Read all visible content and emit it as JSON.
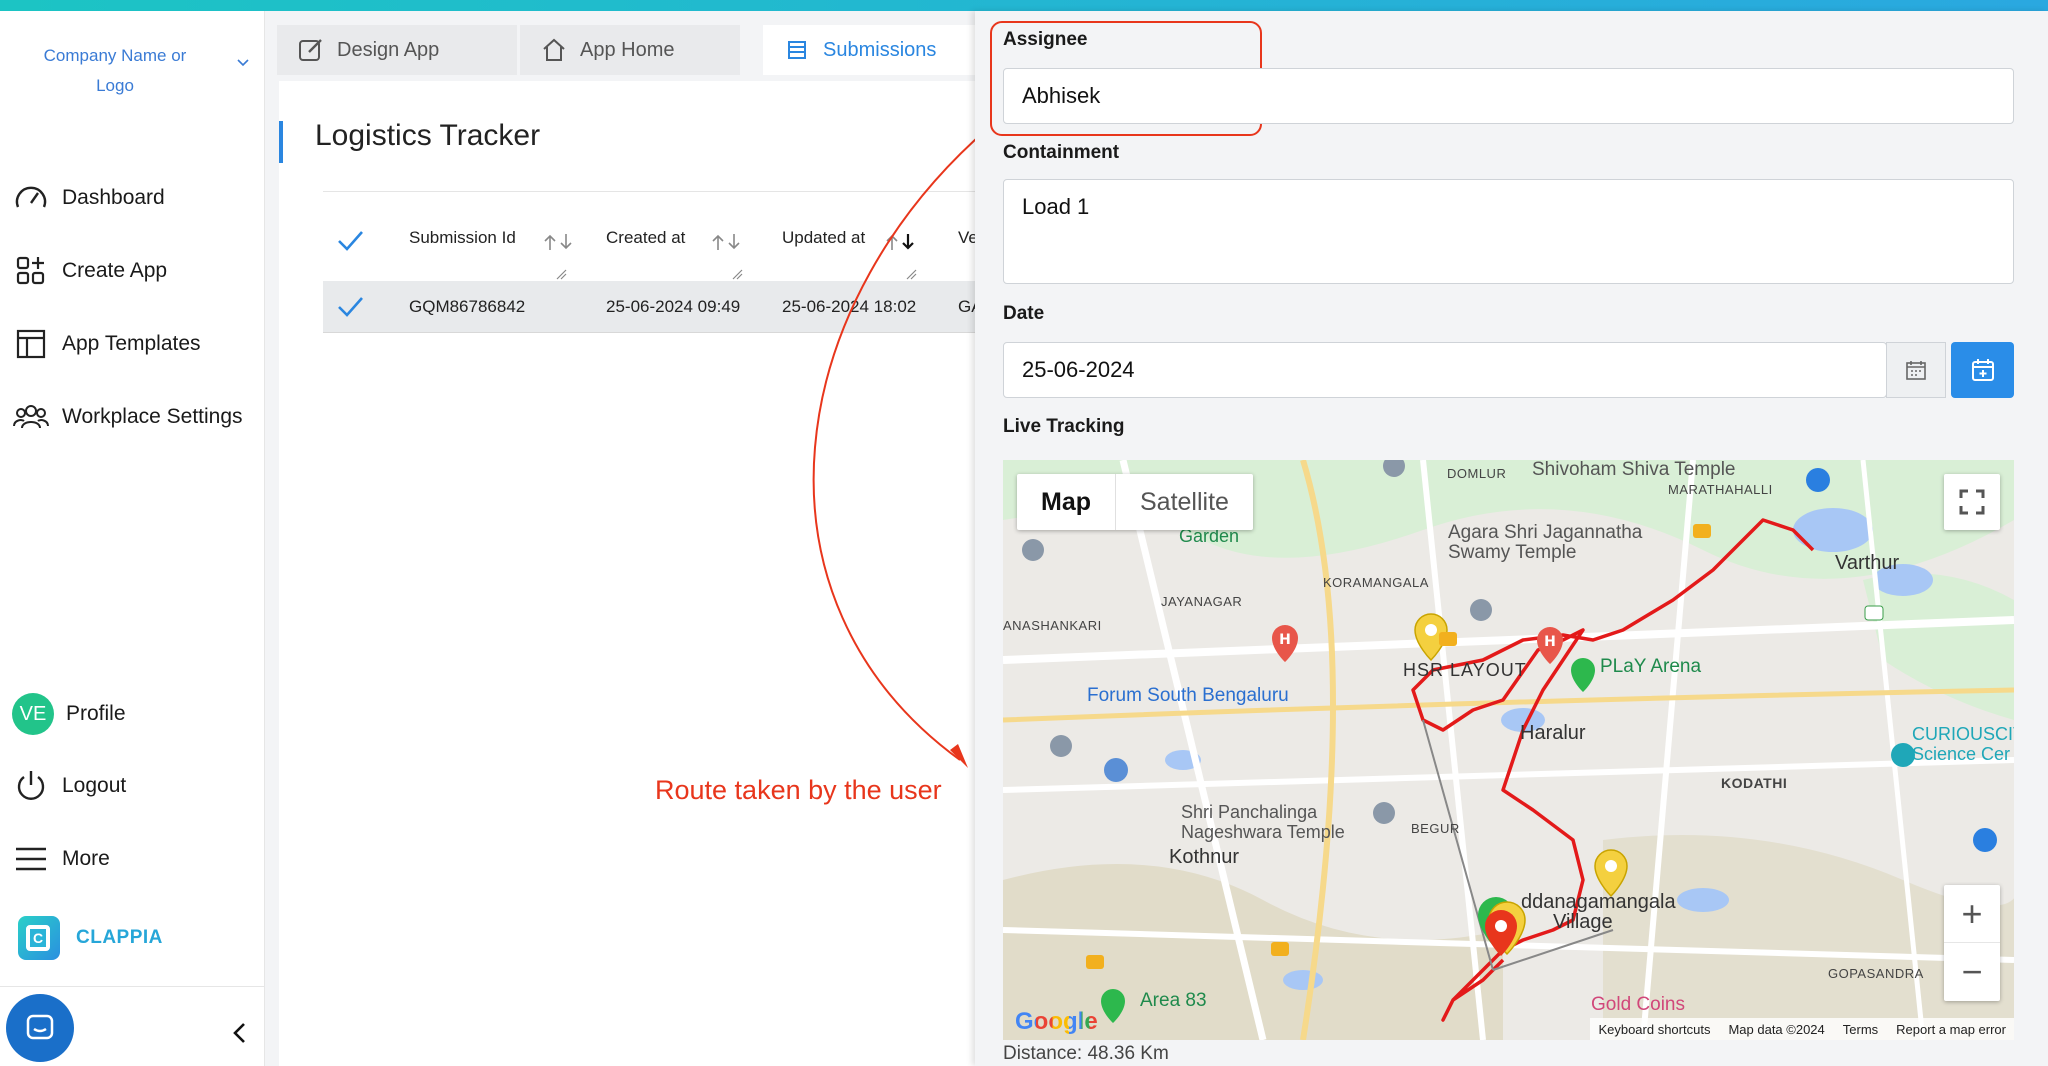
{
  "sidebar": {
    "company": "Company Name or Logo",
    "items": [
      {
        "label": "Dashboard",
        "icon": "speedometer-icon"
      },
      {
        "label": "Create App",
        "icon": "add-app-icon"
      },
      {
        "label": "App Templates",
        "icon": "templates-icon"
      },
      {
        "label": "Workplace Settings",
        "icon": "users-icon"
      }
    ],
    "profile": {
      "initials": "VE",
      "label": "Profile"
    },
    "logout": "Logout",
    "more": "More",
    "brand": "CLAPPIA"
  },
  "tabs": [
    {
      "label": "Design App",
      "icon": "edit-icon"
    },
    {
      "label": "App Home",
      "icon": "home-icon"
    },
    {
      "label": "Submissions",
      "icon": "table-icon",
      "active": true
    }
  ],
  "main": {
    "title": "Logistics Tracker",
    "table": {
      "columns": [
        "Submission Id",
        "Created at",
        "Updated at",
        "Ve"
      ],
      "rows": [
        [
          "GQM86786842",
          "25-06-2024 09:49",
          "25-06-2024 18:02",
          "GA"
        ]
      ]
    },
    "annotation": "Route taken by the user"
  },
  "panel": {
    "assignee_label": "Assignee",
    "assignee_value": "Abhisek",
    "containment_label": "Containment",
    "containment_value": "Load 1",
    "date_label": "Date",
    "date_value": "25-06-2024",
    "live_tracking_label": "Live Tracking",
    "distance": "Distance: 48.36 Km"
  },
  "map": {
    "type_map": "Map",
    "type_satellite": "Satellite",
    "labels": {
      "domlur": "DOMLUR",
      "shivoham": "Shivoham Shiva Temple",
      "marathahalli": "MARATHAHALLI",
      "garden": "Garden",
      "agara": "Agara Shri Jagannatha",
      "swamy": "Swamy Temple",
      "varthur": "Varthur",
      "koramangala": "KORAMANGALA",
      "jayanagar": "JAYANAGAR",
      "banashankari": "ANASHANKARI",
      "hsr": "HSR LAYOUT",
      "play": "PLaY Arena",
      "forum": "Forum South Bengaluru",
      "haralur": "Haralur",
      "curiouscity": "CURIOUSCIT",
      "science": "Science Cer",
      "kodathi": "KODATHI",
      "panchalinga": "Shri Panchalinga",
      "nageshwara": "Nageshwara Temple",
      "kothnur": "Kothnur",
      "dodda": "ddanagamangala",
      "village": "Village",
      "goldcoins": "Gold Coins",
      "area83": "Area 83",
      "gopasandra": "GOPASANDRA",
      "begur": "BEGUR"
    },
    "attribution": [
      "Keyboard shortcuts",
      "Map data ©2024",
      "Terms",
      "Report a map error"
    ],
    "google": "Google",
    "colors": {
      "route": "#e31a1a",
      "pin_yellow": "#f4d03f",
      "pin_green": "#2db84d",
      "pin_red": "#e8361c"
    }
  }
}
